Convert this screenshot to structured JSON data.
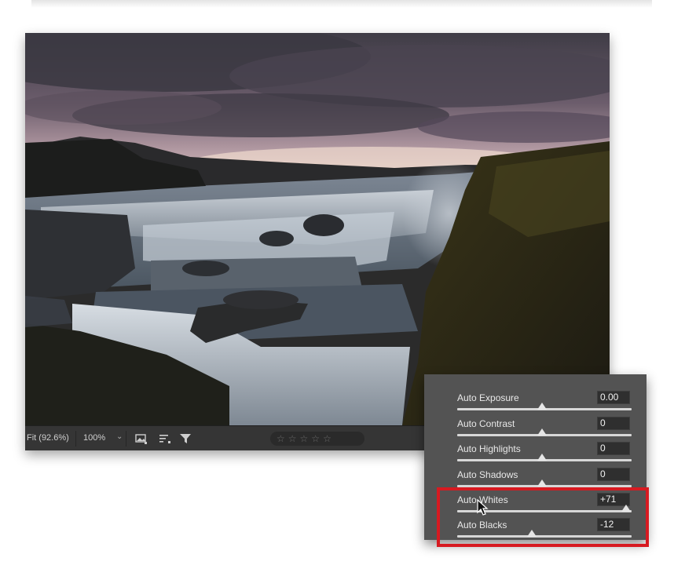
{
  "status_bar": {
    "fit_label": "Fit (92.6%)",
    "zoom_label": "100%",
    "zoom_caret": "⌄",
    "rating_stars": [
      "☆",
      "☆",
      "☆",
      "☆",
      "☆"
    ],
    "icons": [
      "image-options-icon",
      "sort-icon",
      "filter-icon",
      "trash-icon"
    ]
  },
  "auto_panel": {
    "rows": [
      {
        "label": "Auto Exposure",
        "value": "0.00",
        "slider_level": 0.5
      },
      {
        "label": "Auto Contrast",
        "value": "0",
        "slider_level": 0.5
      },
      {
        "label": "Auto Highlights",
        "value": "0",
        "slider_level": 0.5
      },
      {
        "label": "Auto Shadows",
        "value": "0",
        "slider_level": 0.5
      },
      {
        "label": "Auto Whites",
        "value": "+71",
        "slider_level": 0.86
      },
      {
        "label": "Auto Blacks",
        "value": "-12",
        "slider_level": 0.44
      }
    ],
    "highlighted_rows": [
      "Auto Whites",
      "Auto Blacks"
    ],
    "highlight_color": "#d71a21"
  },
  "colors": {
    "panel_background": "#535353",
    "status_bar_background": "#353535"
  }
}
